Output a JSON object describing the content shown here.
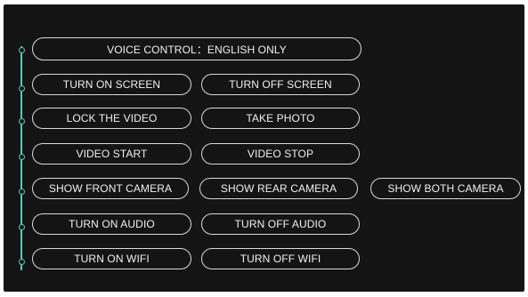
{
  "header": {
    "voice_control": "VOICE CONTROL：ENGLISH ONLY"
  },
  "commands": {
    "turn_on_screen": "TURN ON SCREEN",
    "turn_off_screen": "TURN OFF SCREEN",
    "lock_video": "LOCK THE VIDEO",
    "take_photo": "TAKE PHOTO",
    "video_start": "VIDEO START",
    "video_stop": "VIDEO STOP",
    "show_front_camera": "SHOW FRONT CAMERA",
    "show_rear_camera": "SHOW REAR CAMERA",
    "show_both_camera": "SHOW BOTH CAMERA",
    "turn_on_audio": "TURN ON AUDIO",
    "turn_off_audio": "TURN OFF AUDIO",
    "turn_on_wifi": "TURN ON WIFI",
    "turn_off_wifi": "TURN OFF WIFI"
  },
  "colors": {
    "background": "#141414",
    "accent": "#59c8b6",
    "pill_border": "#d9d9d9",
    "text": "#f0f0f0"
  }
}
